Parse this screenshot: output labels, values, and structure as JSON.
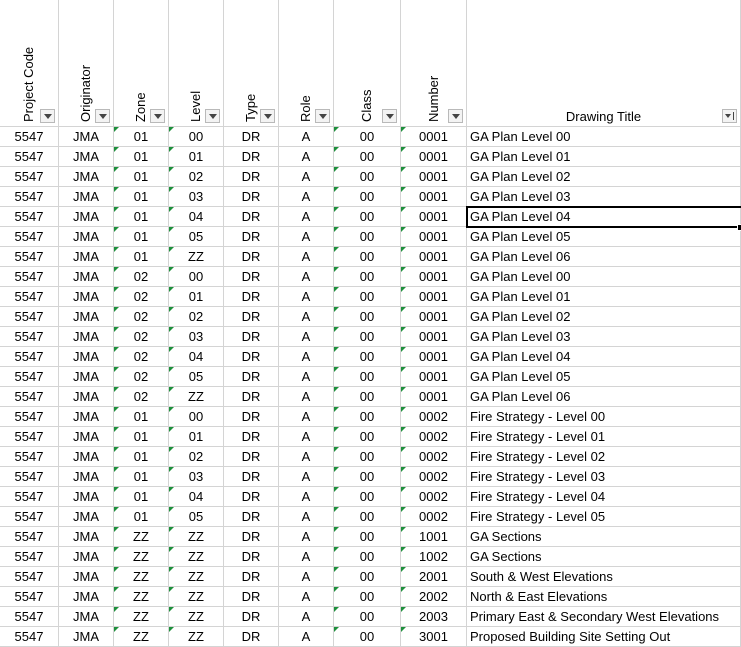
{
  "headers": [
    "Project Code",
    "Originator",
    "Zone",
    "Level",
    "Type",
    "Role",
    "Class",
    "Number",
    "Drawing Title"
  ],
  "rows": [
    [
      "5547",
      "JMA",
      "01",
      "00",
      "DR",
      "A",
      "00",
      "0001",
      "GA Plan Level 00"
    ],
    [
      "5547",
      "JMA",
      "01",
      "01",
      "DR",
      "A",
      "00",
      "0001",
      "GA Plan Level 01"
    ],
    [
      "5547",
      "JMA",
      "01",
      "02",
      "DR",
      "A",
      "00",
      "0001",
      "GA Plan Level 02"
    ],
    [
      "5547",
      "JMA",
      "01",
      "03",
      "DR",
      "A",
      "00",
      "0001",
      "GA Plan Level 03"
    ],
    [
      "5547",
      "JMA",
      "01",
      "04",
      "DR",
      "A",
      "00",
      "0001",
      "GA Plan Level 04"
    ],
    [
      "5547",
      "JMA",
      "01",
      "05",
      "DR",
      "A",
      "00",
      "0001",
      "GA Plan Level 05"
    ],
    [
      "5547",
      "JMA",
      "01",
      "ZZ",
      "DR",
      "A",
      "00",
      "0001",
      "GA Plan Level 06"
    ],
    [
      "5547",
      "JMA",
      "02",
      "00",
      "DR",
      "A",
      "00",
      "0001",
      "GA Plan Level 00"
    ],
    [
      "5547",
      "JMA",
      "02",
      "01",
      "DR",
      "A",
      "00",
      "0001",
      "GA Plan Level 01"
    ],
    [
      "5547",
      "JMA",
      "02",
      "02",
      "DR",
      "A",
      "00",
      "0001",
      "GA Plan Level 02"
    ],
    [
      "5547",
      "JMA",
      "02",
      "03",
      "DR",
      "A",
      "00",
      "0001",
      "GA Plan Level 03"
    ],
    [
      "5547",
      "JMA",
      "02",
      "04",
      "DR",
      "A",
      "00",
      "0001",
      "GA Plan Level 04"
    ],
    [
      "5547",
      "JMA",
      "02",
      "05",
      "DR",
      "A",
      "00",
      "0001",
      "GA Plan Level 05"
    ],
    [
      "5547",
      "JMA",
      "02",
      "ZZ",
      "DR",
      "A",
      "00",
      "0001",
      "GA Plan Level 06"
    ],
    [
      "5547",
      "JMA",
      "01",
      "00",
      "DR",
      "A",
      "00",
      "0002",
      "Fire Strategy - Level 00"
    ],
    [
      "5547",
      "JMA",
      "01",
      "01",
      "DR",
      "A",
      "00",
      "0002",
      "Fire Strategy - Level 01"
    ],
    [
      "5547",
      "JMA",
      "01",
      "02",
      "DR",
      "A",
      "00",
      "0002",
      "Fire Strategy - Level 02"
    ],
    [
      "5547",
      "JMA",
      "01",
      "03",
      "DR",
      "A",
      "00",
      "0002",
      "Fire Strategy - Level 03"
    ],
    [
      "5547",
      "JMA",
      "01",
      "04",
      "DR",
      "A",
      "00",
      "0002",
      "Fire Strategy - Level 04"
    ],
    [
      "5547",
      "JMA",
      "01",
      "05",
      "DR",
      "A",
      "00",
      "0002",
      "Fire Strategy - Level 05"
    ],
    [
      "5547",
      "JMA",
      "ZZ",
      "ZZ",
      "DR",
      "A",
      "00",
      "1001",
      "GA Sections"
    ],
    [
      "5547",
      "JMA",
      "ZZ",
      "ZZ",
      "DR",
      "A",
      "00",
      "1002",
      "GA Sections"
    ],
    [
      "5547",
      "JMA",
      "ZZ",
      "ZZ",
      "DR",
      "A",
      "00",
      "2001",
      "South & West Elevations"
    ],
    [
      "5547",
      "JMA",
      "ZZ",
      "ZZ",
      "DR",
      "A",
      "00",
      "2002",
      "North & East Elevations"
    ],
    [
      "5547",
      "JMA",
      "ZZ",
      "ZZ",
      "DR",
      "A",
      "00",
      "2003",
      "Primary East & Secondary West Elevations"
    ],
    [
      "5547",
      "JMA",
      "ZZ",
      "ZZ",
      "DR",
      "A",
      "00",
      "3001",
      "Proposed Building Site Setting Out"
    ]
  ],
  "colors": {
    "gridline": "#d4d4d4",
    "error_indicator": "#1e8f3c"
  }
}
